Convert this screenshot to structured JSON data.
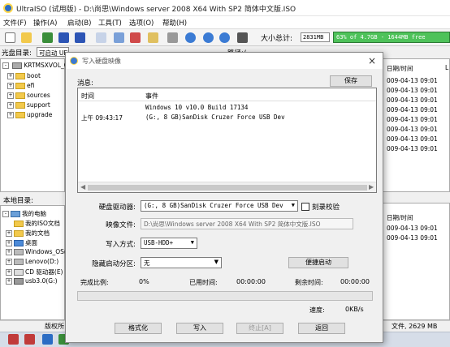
{
  "window": {
    "title": "UltraISO (试用版) - D:\\尚思\\Windows server 2008 X64 With SP2 简体中文版.ISO"
  },
  "menu": [
    "文件(F)",
    "操作(A)",
    "启动(B)",
    "工具(T)",
    "选项(O)",
    "帮助(H)"
  ],
  "toolbar": {
    "size_label": "大小总计:",
    "size_value": "2831MB",
    "capacity_text": "63% of 4.7GB - 1644MB free",
    "capacity_percent": 63
  },
  "cd_panel": {
    "label": "光盘目录:",
    "boot_value": "可启动 UEI",
    "path_label": "路径:/",
    "root": "KRTMSXVOL_CN_D",
    "folders": [
      "boot",
      "efi",
      "sources",
      "support",
      "upgrade"
    ]
  },
  "right_list": {
    "header1": "日期/时间",
    "header1_extra": "L",
    "dates_top": [
      "009-04-13 09:01",
      "009-04-13 09:01",
      "009-04-13 09:01",
      "009-04-13 09:01",
      "009-04-13 09:01",
      "009-04-13 09:01",
      "009-04-13 09:01",
      "009-04-13 09:01"
    ],
    "header2": "日期/时间",
    "dates_bottom": [
      "009-04-13 09:01",
      "009-04-13 09:01"
    ]
  },
  "local_panel": {
    "label": "本地目录:",
    "items": [
      "我的电脑",
      "我的ISO文档",
      "我的文档",
      "桌面",
      "Windows_OS(",
      "Lenovo(D:)",
      "CD 驱动器(E)",
      "usb3.0(G:)"
    ]
  },
  "statusbar": {
    "copyright": "版权所",
    "right_text": "文件, 2629 MB"
  },
  "dialog": {
    "title": "写入硬盘映像",
    "close": "×",
    "message_label": "消息:",
    "save_button": "保存",
    "col_time": "时间",
    "col_event": "事件",
    "log": [
      {
        "time": "",
        "event": "Windows 10 v10.0 Build 17134"
      },
      {
        "time": "上午 09:43:17",
        "event": "(G:, 8 GB)SanDisk Cruzer Force USB Dev"
      }
    ],
    "drive_label": "硬盘驱动器:",
    "drive_value": "(G:, 8 GB)SanDisk Cruzer Force USB Dev",
    "verify_label": "刻录校验",
    "image_label": "映像文件:",
    "image_value": "D:\\尚思\\Windows server 2008 X64 With SP2 简体中文版.ISO",
    "method_label": "写入方式:",
    "method_value": "USB-HDD+",
    "hidden_label": "隐藏启动分区:",
    "hidden_value": "无",
    "boot_button": "便捷启动",
    "done_label": "完成比例:",
    "done_value": "0%",
    "elapsed_label": "已用时间:",
    "elapsed_value": "00:00:00",
    "remaining_label": "剩余时间:",
    "remaining_value": "00:00:00",
    "progress_percent": 0,
    "speed_label": "速度:",
    "speed_value": "0KB/s",
    "buttons": {
      "format": "格式化",
      "write": "写入",
      "stop": "终止[A]",
      "back": "返回"
    }
  }
}
